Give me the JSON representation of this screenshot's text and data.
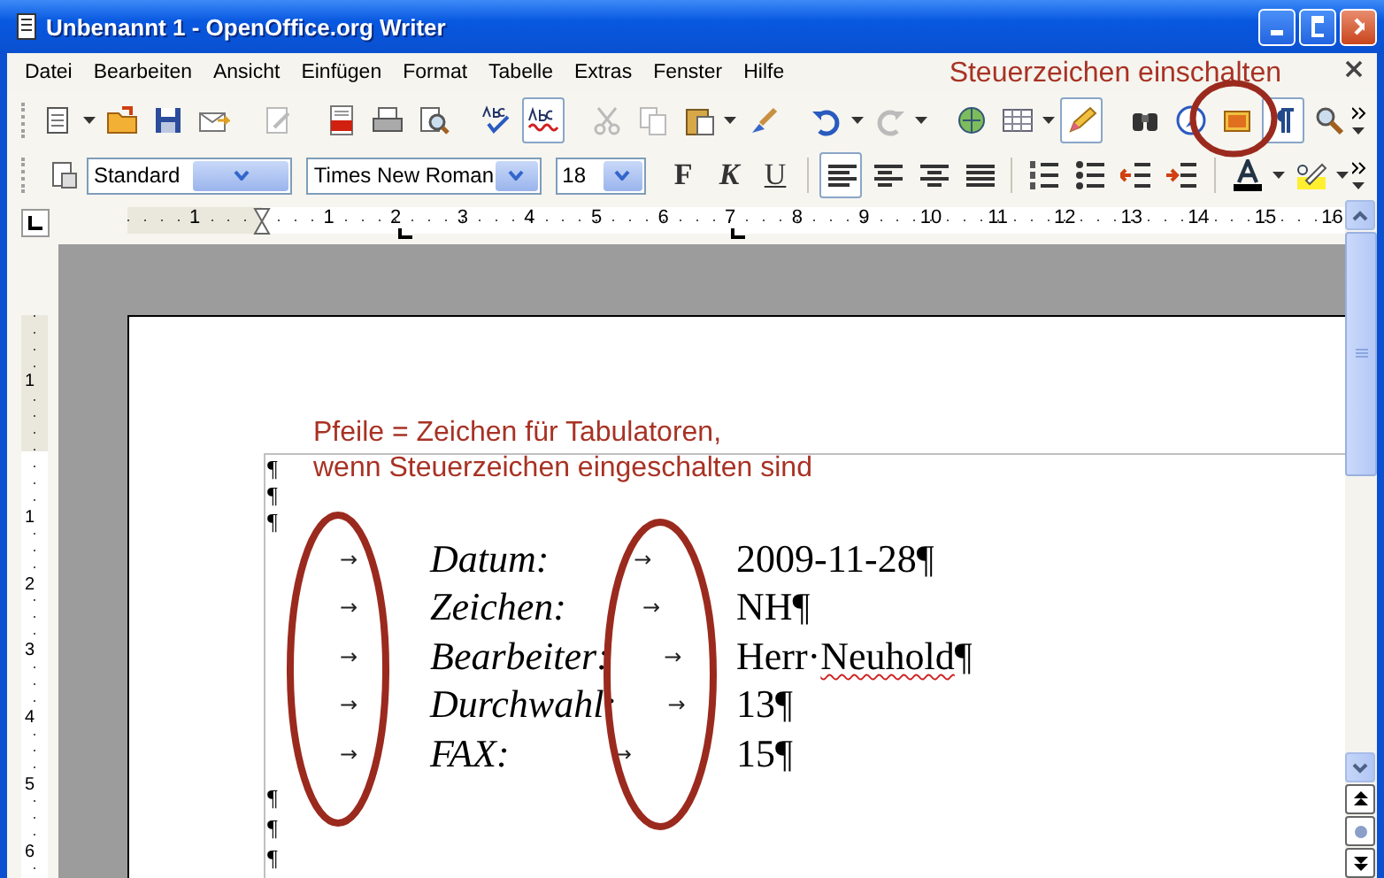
{
  "window": {
    "title": "Unbenannt 1 - OpenOffice.org Writer"
  },
  "menu": {
    "items": [
      "Datei",
      "Bearbeiten",
      "Ansicht",
      "Einfügen",
      "Format",
      "Tabelle",
      "Extras",
      "Fenster",
      "Hilfe"
    ]
  },
  "toolbar_note": "Steuerzeichen einschalten",
  "standard_toolbar": {
    "autospellcheck_on": true,
    "draw_functions_on": true,
    "formatting_marks_on": true
  },
  "formatting_toolbar": {
    "style": "Standard",
    "font": "Times New Roman",
    "size": "18",
    "bold_label": "F",
    "italic_label": "K",
    "underline_label": "U",
    "alignment": [
      {
        "selected": true
      },
      {
        "selected": false
      },
      {
        "selected": false
      },
      {
        "selected": false
      }
    ]
  },
  "ruler": {
    "labels": [
      "1",
      "1",
      "2",
      "3",
      "4",
      "5",
      "6",
      "7",
      "8",
      "9",
      "10",
      "11",
      "12",
      "13",
      "14",
      "15",
      "16"
    ]
  },
  "vertical_ruler": {
    "labels": [
      "1",
      "1",
      "2",
      "3",
      "4",
      "5",
      "6"
    ]
  },
  "document": {
    "note": [
      "Pfeile = Zeichen für Tabulatoren,",
      "wenn Steuerzeichen eingeschalten sind"
    ],
    "leading_marks": [
      "¶",
      "¶",
      "¶"
    ],
    "rows": [
      {
        "tab_mark_1": "→",
        "label": "Datum:",
        "tab_mark_2": "→",
        "value_parts": [
          {
            "text": "2009-11-28",
            "misspelled": false
          }
        ],
        "mark": "¶"
      },
      {
        "tab_mark_1": "→",
        "label": "Zeichen:",
        "tab_mark_2": "→",
        "value_parts": [
          {
            "text": "NH",
            "misspelled": false
          }
        ],
        "mark": "¶"
      },
      {
        "tab_mark_1": "→",
        "label": "Bearbeiter:",
        "tab_mark_2": "→",
        "value_parts": [
          {
            "text": "Herr·",
            "misspelled": false
          },
          {
            "text": "Neuhold",
            "misspelled": true
          }
        ],
        "mark": "¶"
      },
      {
        "tab_mark_1": "→",
        "label": "Durchwahl:",
        "tab_mark_2": "→",
        "value_parts": [
          {
            "text": "13",
            "misspelled": false
          }
        ],
        "mark": "¶"
      },
      {
        "tab_mark_1": "→",
        "label": "FAX:",
        "tab_mark_2": "→",
        "value_parts": [
          {
            "text": "15",
            "misspelled": false
          }
        ],
        "mark": "¶"
      }
    ],
    "trailing_marks": [
      "¶",
      "¶",
      "¶"
    ]
  }
}
